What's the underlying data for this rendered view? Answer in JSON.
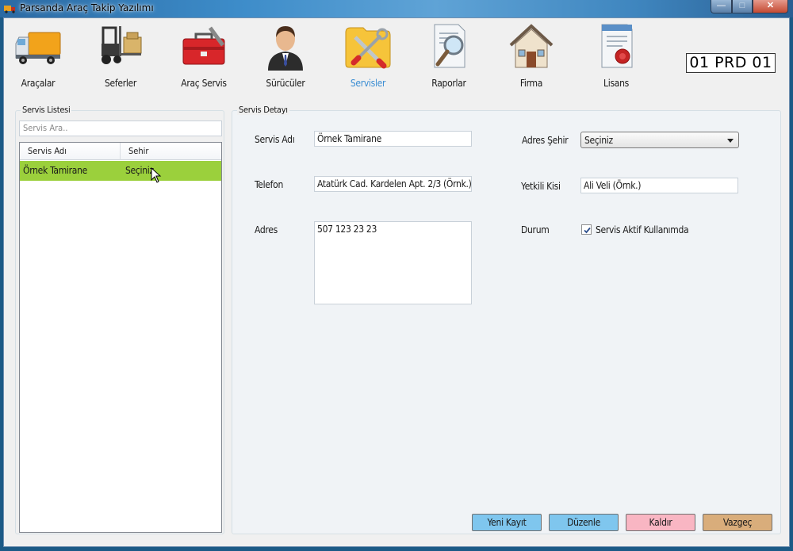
{
  "window": {
    "title": "Parsanda Araç Takip Yazılımı"
  },
  "toolbar": {
    "items": [
      {
        "label": "Araçalar",
        "icon": "truck-icon"
      },
      {
        "label": "Seferler",
        "icon": "forklift-icon"
      },
      {
        "label": "Araç Servis",
        "icon": "toolbox-icon"
      },
      {
        "label": "Sürücüler",
        "icon": "driver-icon"
      },
      {
        "label": "Servisler",
        "icon": "tools-icon",
        "active": true
      },
      {
        "label": "Raporlar",
        "icon": "report-icon"
      },
      {
        "label": "Firma",
        "icon": "house-icon"
      },
      {
        "label": "Lisans",
        "icon": "certificate-icon"
      }
    ],
    "plate": "01 PRD 01"
  },
  "list_panel": {
    "title": "Servis Listesi",
    "search_placeholder": "Servis Ara..",
    "columns": [
      "Servis Adı",
      "Sehir"
    ],
    "rows": [
      {
        "name": "Örnek Tamirane",
        "city": "Seçiniz"
      }
    ],
    "selected_color": "#9bd03c"
  },
  "detail_panel": {
    "title": "Servis Detayı",
    "labels": {
      "name": "Servis Adı",
      "phone": "Telefon",
      "address": "Adres",
      "city": "Adres Şehir",
      "contact": "Yetkili Kisi",
      "status": "Durum"
    },
    "values": {
      "name": "Örnek Tamirane",
      "phone": "Atatürk Cad. Kardelen Apt. 2/3 (Örnk.)",
      "address": "507 123 23 23",
      "city": "Seçiniz",
      "contact": "Ali Veli (Örnk.)",
      "status_checkbox": "Servis Aktif Kullanımda",
      "status_checked": true
    }
  },
  "buttons": {
    "new": {
      "label": "Yeni Kayıt",
      "color": "#7fc6ee"
    },
    "edit": {
      "label": "Düzenle",
      "color": "#7fc6ee"
    },
    "delete": {
      "label": "Kaldır",
      "color": "#f9b6c3"
    },
    "cancel": {
      "label": "Vazgeç",
      "color": "#d9ad7b"
    }
  }
}
